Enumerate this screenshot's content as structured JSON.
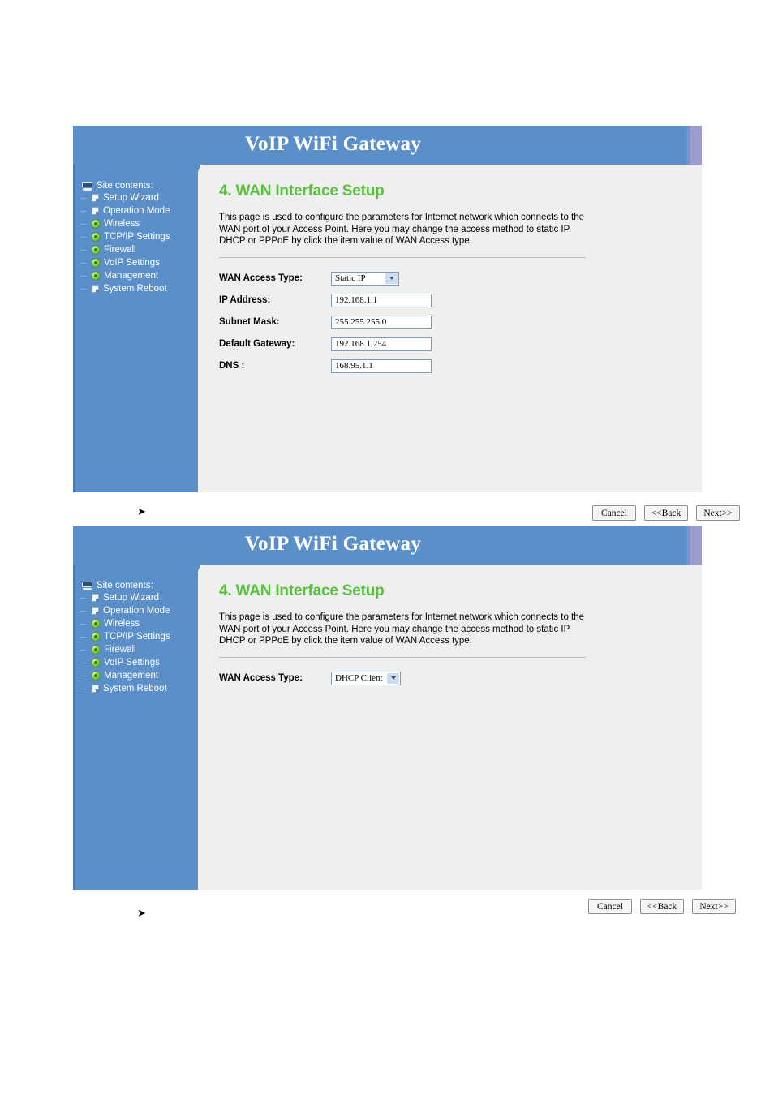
{
  "document": {
    "bullets": [
      "➤",
      "➤"
    ]
  },
  "brand": {
    "title": "VoIP WiFi Gateway"
  },
  "sidebar": {
    "heading": "Site contents:",
    "heading_icon": "monitor-icon",
    "items": [
      {
        "label": "Setup Wizard",
        "icon": "page-icon"
      },
      {
        "label": "Operation Mode",
        "icon": "page-icon"
      },
      {
        "label": "Wireless",
        "icon": "green-bullet-icon"
      },
      {
        "label": "TCP/IP Settings",
        "icon": "green-bullet-icon"
      },
      {
        "label": "Firewall",
        "icon": "green-bullet-icon"
      },
      {
        "label": "VoIP Settings",
        "icon": "green-bullet-icon"
      },
      {
        "label": "Management",
        "icon": "green-bullet-icon"
      },
      {
        "label": "System Reboot",
        "icon": "page-icon"
      }
    ]
  },
  "screens": {
    "static_ip": {
      "page_title": "4. WAN Interface Setup",
      "description": "This page is used to configure the parameters for Internet network which connects to the WAN port of your Access Point. Here you may change the access method to static IP, DHCP or PPPoE by click the item value of WAN Access type.",
      "fields": {
        "wan_access_type_label": "WAN Access Type:",
        "wan_access_type_value": "Static IP",
        "ip_address_label": "IP Address:",
        "ip_address_value": "192.168.1.1",
        "subnet_mask_label": "Subnet Mask:",
        "subnet_mask_value": "255.255.255.0",
        "default_gateway_label": "Default Gateway:",
        "default_gateway_value": "192.168.1.254",
        "dns_label": "DNS :",
        "dns_value": "168.95.1.1"
      },
      "buttons": {
        "cancel": "Cancel",
        "back": "<<Back",
        "next": "Next>>"
      }
    },
    "dhcp_client": {
      "page_title": "4. WAN Interface Setup",
      "description": "This page is used to configure the parameters for Internet network which connects to the WAN port of your Access Point. Here you may change the access method to static IP, DHCP or PPPoE by click the item value of WAN Access type.",
      "fields": {
        "wan_access_type_label": "WAN Access Type:",
        "wan_access_type_value": "DHCP Client"
      },
      "buttons": {
        "cancel": "Cancel",
        "back": "<<Back",
        "next": "Next>>"
      }
    }
  },
  "colors": {
    "sidebar_blue": "#5b8fc9",
    "header_accent": "#9b9dd0",
    "title_green": "#58c13a",
    "panel_grey": "#eeefee"
  }
}
